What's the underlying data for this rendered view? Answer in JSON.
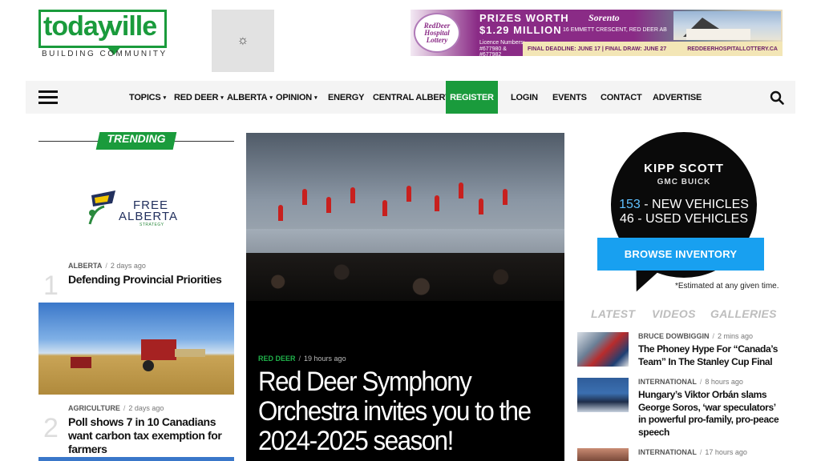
{
  "header": {
    "logo": {
      "today": "today",
      "ville": "ville",
      "tagline": "BUILDING   COMMUNITY"
    },
    "weather_icon": "sun-icon",
    "ad": {
      "badge": "RedDeer Hospital Lottery",
      "prize_line": "PRIZES WORTH",
      "amount": "$1.29 MILLION",
      "licence": "Licence Numbers: #677980 & #677982",
      "builder": "Sorento",
      "address": "16 EMMETT CRESCENT, RED DEER AB",
      "deadline": "FINAL DEADLINE: JUNE 17  |  FINAL DRAW: JUNE 27",
      "url": "REDDEERHOSPITALLOTTERY.CA"
    }
  },
  "nav": {
    "items": [
      {
        "label": "TOPICS",
        "caret": true
      },
      {
        "label": "RED DEER",
        "caret": true
      },
      {
        "label": "ALBERTA",
        "caret": true
      },
      {
        "label": "OPINION",
        "caret": true
      },
      {
        "label": "ENERGY",
        "caret": false
      },
      {
        "label": "CENTRAL ALBERTA",
        "caret": true
      },
      {
        "label": "REGISTER",
        "caret": false
      },
      {
        "label": "LOGIN",
        "caret": false
      },
      {
        "label": "EVENTS",
        "caret": false
      },
      {
        "label": "CONTACT",
        "caret": false
      },
      {
        "label": "ADVERTISE",
        "caret": false
      }
    ],
    "caret_glyph": "▾",
    "accent": "#1a9b3c"
  },
  "trending": {
    "heading": "TRENDING",
    "sponsor": {
      "free": "FREE",
      "alberta": "ALBERTA",
      "strategy": "STRATEGY"
    },
    "items": [
      {
        "num": "1",
        "category": "ALBERTA",
        "age": "2 days ago",
        "title": "Defending Provincial Priorities"
      },
      {
        "num": "2",
        "category": "AGRICULTURE",
        "age": "2 days ago",
        "title": "Poll shows 7 in 10 Canadians want carbon tax exemption for farmers"
      }
    ],
    "separator": "/"
  },
  "feature": {
    "category": "RED DEER",
    "age": "19 hours ago",
    "title": "Red Deer Symphony Orchestra invites you to the 2024-2025 season!"
  },
  "sidebar": {
    "ad": {
      "name": "KIPP SCOTT",
      "brands": "GMC  BUICK",
      "new_count": "153",
      "new_label": "- NEW VEHICLES",
      "used": "46 - USED VEHICLES",
      "button": "BROWSE INVENTORY",
      "note": "*Estimated at any given time."
    },
    "tabs": [
      "LATEST",
      "VIDEOS",
      "GALLERIES"
    ],
    "items": [
      {
        "category": "BRUCE DOWBIGGIN",
        "age": "2 mins ago",
        "title": "The Phoney Hype For “Canada’s Team” In The Stanley Cup Final"
      },
      {
        "category": "INTERNATIONAL",
        "age": "8 hours ago",
        "title": "Hungary’s Viktor Orbán slams George Soros, ‘war speculators’ in powerful pro-family, pro-peace speech"
      },
      {
        "category": "INTERNATIONAL",
        "age": "17 hours ago",
        "title": ""
      }
    ]
  }
}
